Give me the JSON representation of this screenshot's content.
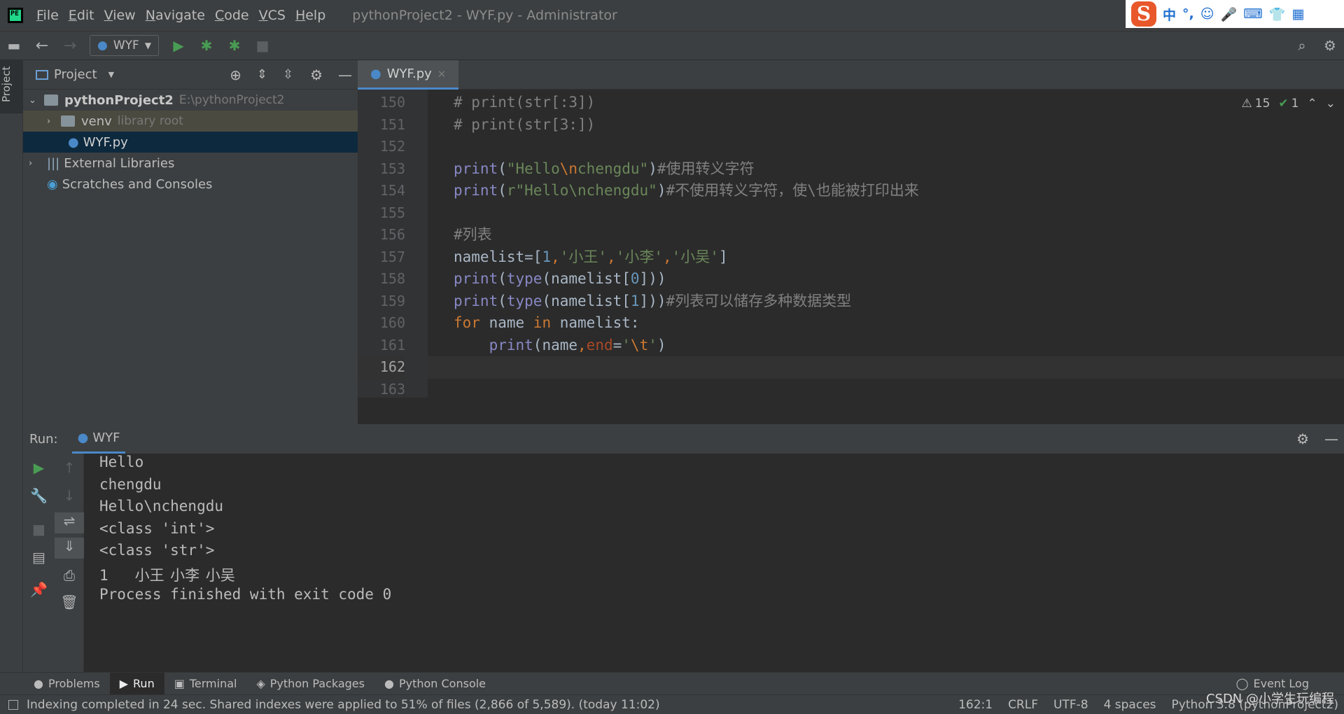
{
  "menu": [
    "File",
    "Edit",
    "View",
    "Navigate",
    "Code",
    "VCS",
    "Help"
  ],
  "window_title": "pythonProject2 - WYF.py - Administrator",
  "ime_icons": [
    "中",
    "°,",
    "☺",
    "🎤",
    "⌨",
    "👕",
    "▦"
  ],
  "toolbar": {
    "run_config": "WYF"
  },
  "project_panel": {
    "title": "Project",
    "tree": [
      {
        "name": "pythonProject2",
        "note": "E:\\pythonProject2"
      },
      {
        "name": "venv",
        "note": "library root"
      },
      {
        "name": "WYF.py",
        "note": ""
      },
      {
        "name": "External Libraries",
        "note": ""
      },
      {
        "name": "Scratches and Consoles",
        "note": ""
      }
    ]
  },
  "side_tab": "Project",
  "editor": {
    "tab": "WYF.py",
    "inspections": {
      "warnings": "15",
      "checks": "1"
    },
    "line_numbers": [
      "150",
      "151",
      "152",
      "153",
      "154",
      "155",
      "156",
      "157",
      "158",
      "159",
      "160",
      "161",
      "162",
      "163"
    ]
  },
  "run": {
    "label": "Run:",
    "tab": "WYF",
    "output": [
      "Hello",
      "chengdu",
      "Hello\\nchengdu",
      "<class 'int'>",
      "<class 'str'>",
      "1\t小王\t小李\t小吴\t",
      "Process finished with exit code 0"
    ]
  },
  "bottom_tabs": [
    "Problems",
    "Run",
    "Terminal",
    "Python Packages",
    "Python Console"
  ],
  "event_log": "Event Log",
  "status": {
    "message": "Indexing completed in 24 sec. Shared indexes were applied to 51% of files (2,866 of 5,589). (today 11:02)",
    "position": "162:1",
    "line_sep": "CRLF",
    "encoding": "UTF-8",
    "indent": "4 spaces",
    "interpreter": "Python 3.8 (pythonProject2)",
    "watermark": "CSDN @小学生玩编程"
  },
  "colors": {
    "keyword": "#cc7832",
    "builtin": "#8888c6",
    "string": "#6a8759",
    "comment": "#808080",
    "number": "#6897bb",
    "selection": "#0d293e"
  }
}
